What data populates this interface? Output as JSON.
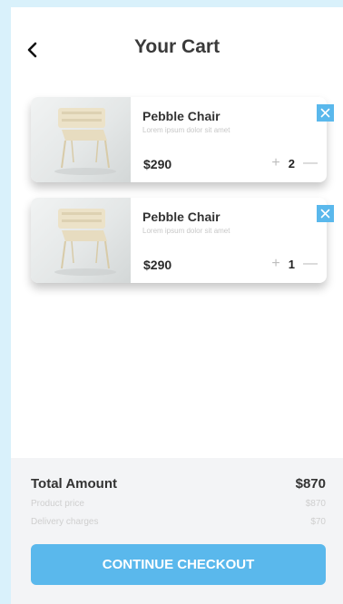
{
  "header": {
    "title": "Your Cart",
    "back_icon": "chevron-left-icon"
  },
  "cart": {
    "items": [
      {
        "name": "Pebble Chair",
        "description": "Lorem ipsum dolor sit amet",
        "price": "$290",
        "quantity": "2",
        "plus": "+",
        "minus": "—"
      },
      {
        "name": "Pebble Chair",
        "description": "Lorem ipsum dolor sit amet",
        "price": "$290",
        "quantity": "1",
        "plus": "+",
        "minus": "—"
      }
    ]
  },
  "summary": {
    "total_label": "Total Amount",
    "total_value": "$870",
    "product_label": "Product price",
    "product_value": "$870",
    "delivery_label": "Delivery charges",
    "delivery_value": "$70"
  },
  "checkout": {
    "label": "CONTINUE CHECKOUT"
  },
  "colors": {
    "accent": "#5ab8ec",
    "background": "#d9f1fb",
    "summary_bg": "#f3f4f6"
  }
}
